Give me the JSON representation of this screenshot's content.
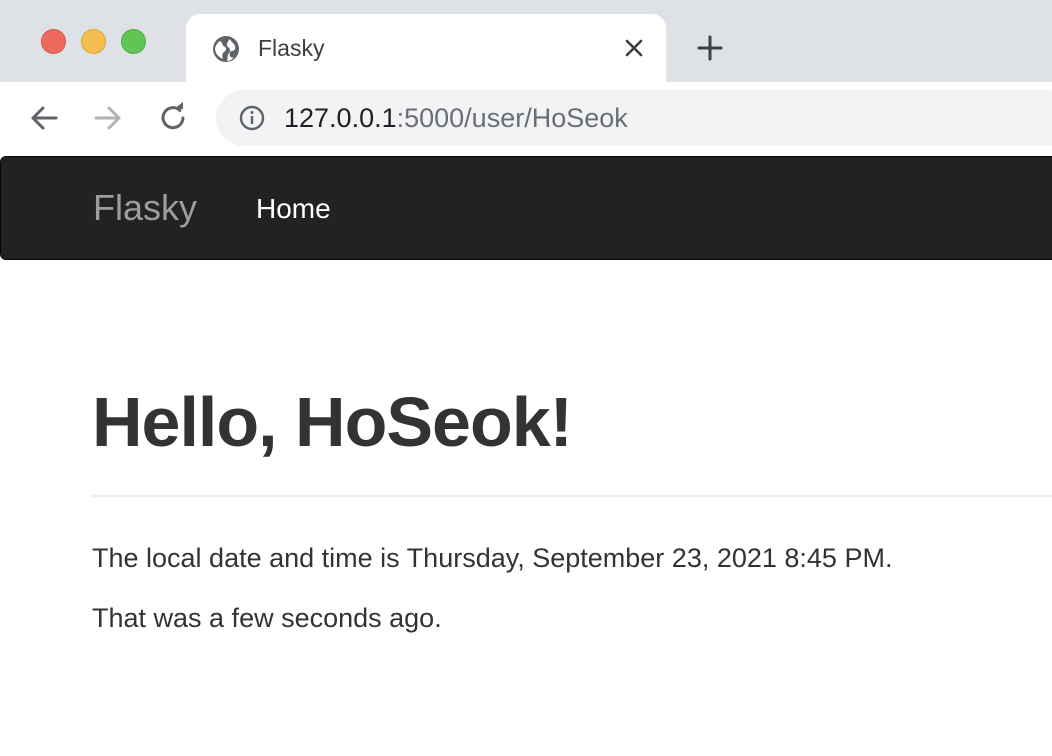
{
  "browser": {
    "tab": {
      "title": "Flasky",
      "favicon": "globe-icon"
    },
    "address_bar": {
      "host": "127.0.0.1",
      "rest": ":5000/user/HoSeok"
    },
    "icons": {
      "back": "arrow-left-icon",
      "forward": "arrow-right-icon",
      "reload": "reload-icon",
      "info": "info-icon",
      "close_tab": "close-icon",
      "new_tab": "plus-icon"
    },
    "window_controls": {
      "close_color": "#ed6a5e",
      "minimize_color": "#f5bf4f",
      "zoom_color": "#61c554"
    }
  },
  "navbar": {
    "brand": "Flasky",
    "links": [
      {
        "label": "Home"
      }
    ],
    "background": "#222222"
  },
  "main": {
    "heading": "Hello, HoSeok!",
    "datetime_text": "The local date and time is Thursday, September 23, 2021 8:45 PM.",
    "relative_text": "That was a few seconds ago."
  }
}
